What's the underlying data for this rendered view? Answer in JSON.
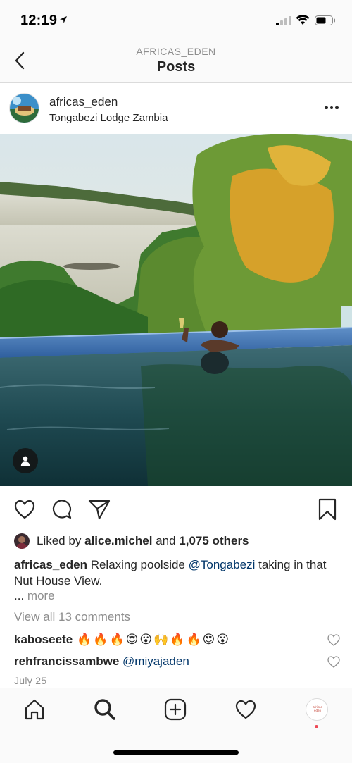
{
  "status": {
    "time": "12:19"
  },
  "header": {
    "account": "AFRICAS_EDEN",
    "title": "Posts"
  },
  "post": {
    "username": "africas_eden",
    "location": "Tongabezi Lodge Zambia",
    "likes": {
      "prefix": "Liked by",
      "user": "alice.michel",
      "and": "and",
      "count": "1,075 others"
    },
    "caption": {
      "user": "africas_eden",
      "text_before": "Relaxing poolside",
      "mention": "@Tongabezi",
      "text_after": "taking in that Nut House View."
    },
    "more": {
      "dots": "...",
      "label": "more"
    },
    "view_all_comments": "View all 13 comments",
    "comments": [
      {
        "user": "kaboseete",
        "text": "🔥🔥🔥😍😮🙌🔥🔥😍😮"
      },
      {
        "user": "rehfrancissambwe",
        "text": "@miyajaden"
      }
    ],
    "date": "July 25"
  },
  "profile_tab": {
    "mini_text": "africas eden"
  },
  "icons": {
    "back": "chevron-left-icon",
    "more": "ellipsis-icon",
    "tag": "person-icon",
    "like": "heart-icon",
    "comment": "comment-bubble-icon",
    "share": "paper-plane-icon",
    "save": "bookmark-icon",
    "home": "home-icon",
    "search": "search-icon",
    "new_post": "plus-square-icon",
    "activity": "heart-icon",
    "profile": "profile-avatar-icon"
  },
  "colors": {
    "link": "#003569",
    "muted": "#8e8e8e",
    "text": "#262626",
    "notification": "#ed4956"
  }
}
